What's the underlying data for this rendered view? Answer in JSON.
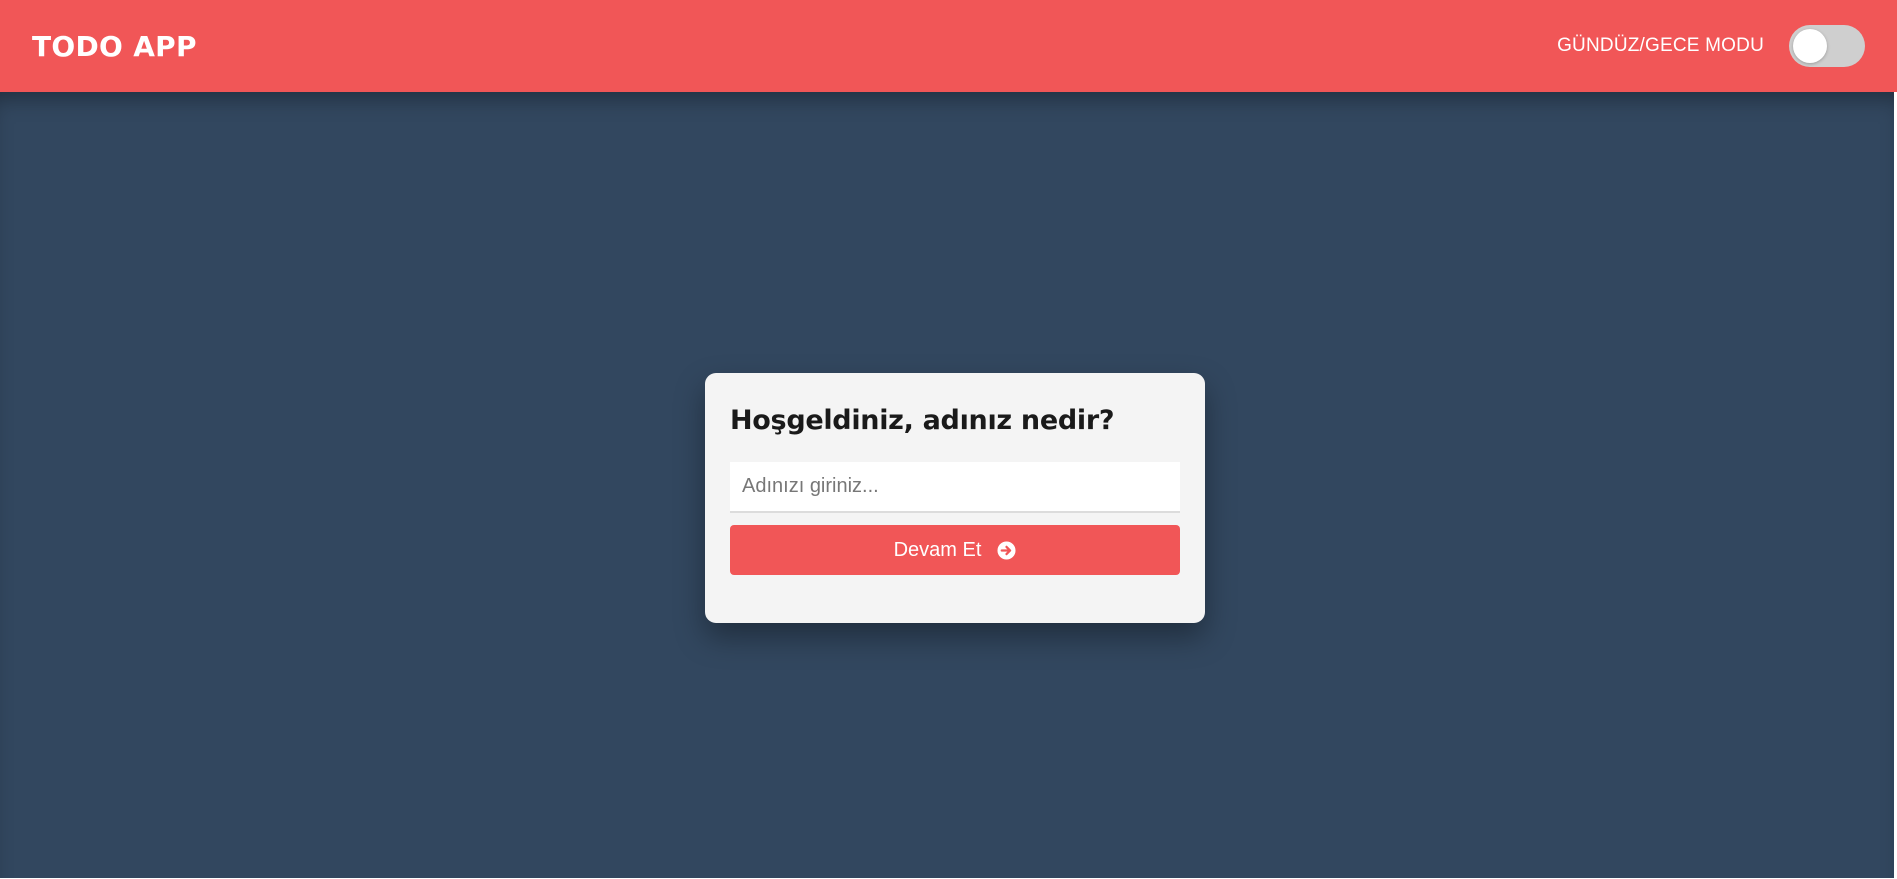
{
  "header": {
    "brand": "TODO APP",
    "mode_label": "GÜNDÜZ/GECE MODU",
    "mode_toggle_on": false
  },
  "welcome": {
    "title": "Hoşgeldiniz, adınız nedir?",
    "input_value": "",
    "input_placeholder": "Adınızı giriniz...",
    "button_label": "Devam Et",
    "button_icon": "arrow-circle-right-icon"
  },
  "colors": {
    "accent": "#f15657",
    "background": "#32475f",
    "card": "#f4f4f4",
    "toggle_track": "#cfcfcf"
  }
}
